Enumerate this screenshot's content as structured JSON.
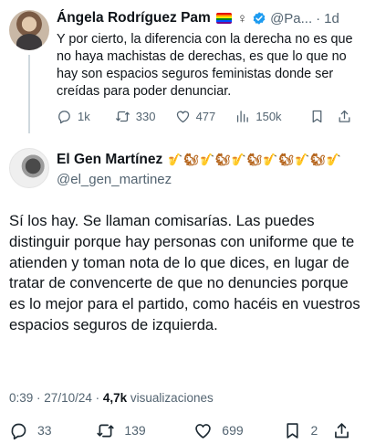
{
  "parent_tweet": {
    "author_name": "Ángela Rodríguez Pam",
    "gender_symbol": "♀",
    "handle": "@Pa...",
    "separator": "·",
    "time": "1d",
    "text": "Y por cierto, la diferencia con la derecha no es que no haya machistas de derechas, es que lo que no hay son espacios seguros feministas donde ser creídas para poder denunciar.",
    "actions": {
      "replies": "1k",
      "reposts": "330",
      "likes": "477",
      "views": "150k"
    }
  },
  "main_tweet": {
    "author_name": "El Gen Martínez",
    "name_emoji": [
      "sax",
      "squirrel",
      "sax",
      "squirrel",
      "sax",
      "squirrel",
      "sax",
      "squirrel",
      "sax",
      "squirrel",
      "sax"
    ],
    "handle": "@el_gen_martinez",
    "text": "Sí los hay. Se llaman comisarías. Las puedes distinguir porque hay personas con uniforme que te atienden y toman nota de lo que dices, en lugar de tratar de convencerte de que no denuncies porque es lo mejor para el partido, como hacéis en vuestros espacios seguros de izquierda.",
    "time": "0:39",
    "date": "27/10/24",
    "views_count": "4,7k",
    "views_label": "visualizaciones",
    "actions": {
      "replies": "33",
      "reposts": "139",
      "likes": "699",
      "bookmarks": "2"
    }
  },
  "colors": {
    "text": "#0f1419",
    "secondary": "#536471",
    "verified_badge": "#1d9bf0",
    "thread_line": "#cfd9de"
  }
}
